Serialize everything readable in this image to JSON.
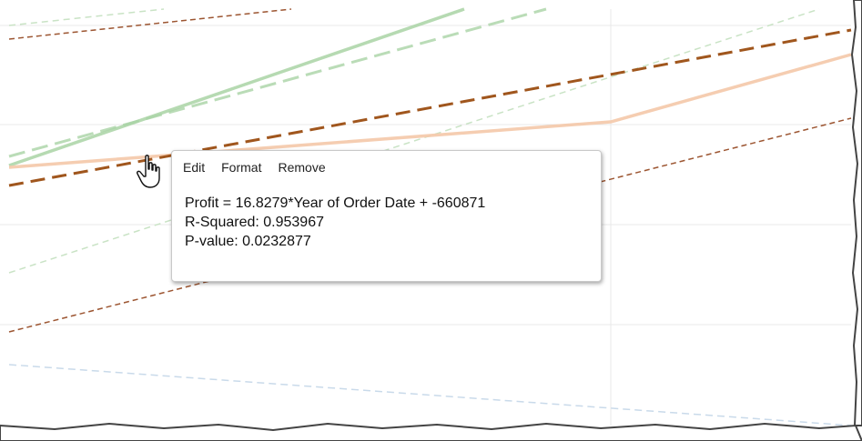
{
  "tooltip": {
    "menu": {
      "edit_label": "Edit",
      "format_label": "Format",
      "remove_label": "Remove"
    },
    "equation": "Profit = 16.8279*Year of Order Date + -660871",
    "r_squared": "R-Squared: 0.953967",
    "p_value": "P-value: 0.0232877"
  },
  "colors": {
    "grid": "#e6e6e6",
    "green": "#a9d3a5",
    "light_green": "#c9e3c5",
    "brown_dark": "#a0561d",
    "brown": "#9c5531",
    "peach": "#f4c8a8",
    "light_blue": "#c9daea",
    "edge_shadow": "#555555"
  },
  "icons": {
    "cursor": "hand-pointer-icon"
  }
}
